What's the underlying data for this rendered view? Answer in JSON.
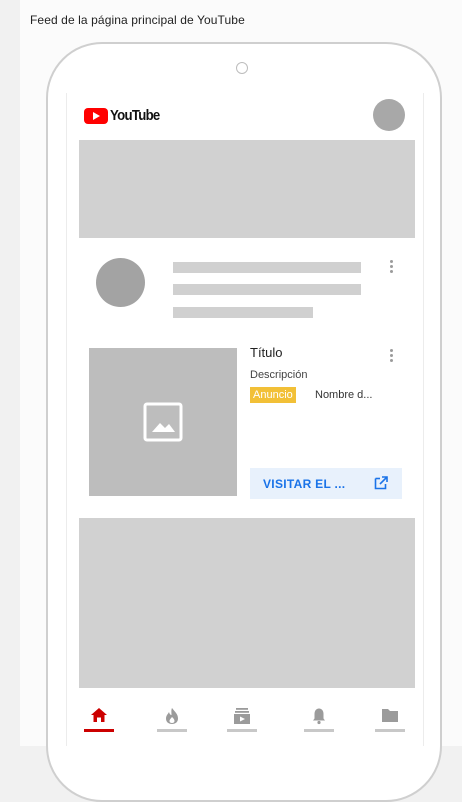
{
  "caption": "Feed de la página principal de YouTube",
  "header": {
    "brand": "YouTube",
    "brand_color": "#ff0000"
  },
  "ad": {
    "title": "Título",
    "description": "Descripción",
    "badge": "Anuncio",
    "badge_color": "#f2c037",
    "advertiser": "Nombre d...",
    "cta_label": "VISITAR EL ...",
    "cta_color": "#1a73e8"
  },
  "icons": {
    "thumbnail": "image-placeholder-icon",
    "cta": "external-link-icon",
    "more": "more-vert-icon"
  },
  "bottom_nav": [
    {
      "id": "home",
      "icon": "home-icon",
      "active": true
    },
    {
      "id": "trending",
      "icon": "flame-icon",
      "active": false
    },
    {
      "id": "subscriptions",
      "icon": "subscriptions-icon",
      "active": false
    },
    {
      "id": "notifications",
      "icon": "bell-icon",
      "active": false
    },
    {
      "id": "library",
      "icon": "folder-icon",
      "active": false
    }
  ]
}
